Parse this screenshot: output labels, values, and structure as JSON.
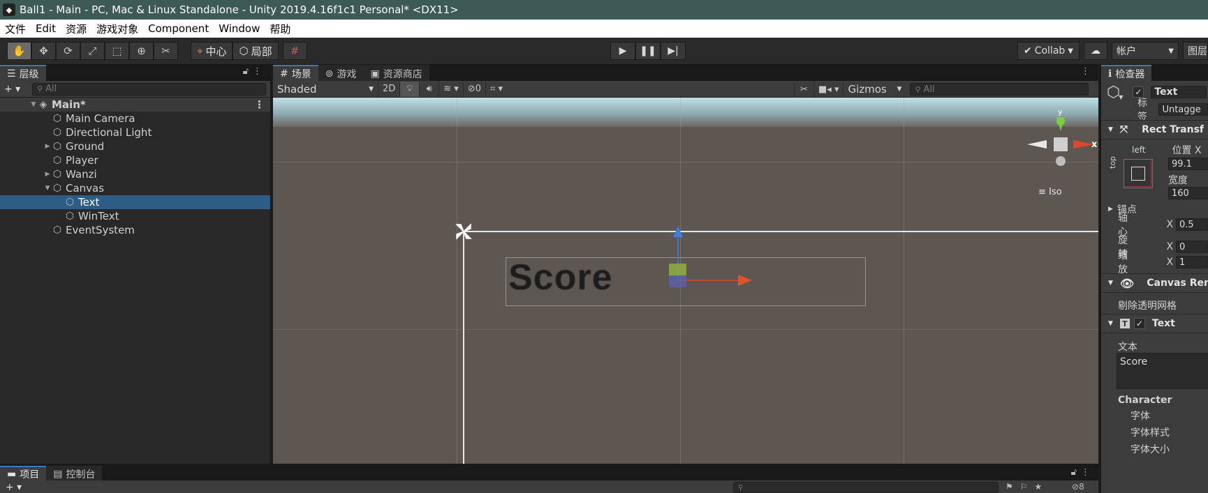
{
  "window": {
    "title": "Ball1 - Main - PC, Mac & Linux Standalone - Unity 2019.4.16f1c1 Personal* <DX11>"
  },
  "menu": [
    "文件",
    "Edit",
    "资源",
    "游戏对象",
    "Component",
    "Window",
    "帮助"
  ],
  "toolbar": {
    "pivot_center": "中心",
    "pivot_local": "局部",
    "collab": "Collab",
    "account": "帐户",
    "layout": "图层"
  },
  "hierarchy": {
    "tab": "层级",
    "search_placeholder": "All",
    "scene": "Main*",
    "items": [
      {
        "label": "Main Camera"
      },
      {
        "label": "Directional Light"
      },
      {
        "label": "Ground"
      },
      {
        "label": "Player"
      },
      {
        "label": "Wanzi"
      },
      {
        "label": "Canvas"
      },
      {
        "label": "Text"
      },
      {
        "label": "WinText"
      },
      {
        "label": "EventSystem"
      }
    ]
  },
  "scene_view": {
    "tabs": [
      "场景",
      "游戏",
      "资源商店"
    ],
    "shading": "Shaded",
    "mode_2d": "2D",
    "hidden_count": "0",
    "gizmos": "Gizmos",
    "search_placeholder": "All",
    "score_text": "Score",
    "axis_x": "x",
    "iso": "Iso"
  },
  "inspector": {
    "tab": "检查器",
    "object_name": "Text",
    "tag_label": "标签",
    "tag_value": "Untagge",
    "rect_transform": "Rect Transf",
    "anchor_h": "left",
    "anchor_v": "top",
    "pos_x_label": "位置 X",
    "pos_x": "99.1",
    "width_label": "宽度",
    "width": "160",
    "anchors": "锚点",
    "pivot_label": "轴心",
    "pivot_x": "0.5",
    "rotation_label": "旋转",
    "rotation_x": "0",
    "scale_label": "缩放",
    "scale_x": "1",
    "axis": "X",
    "canvas_renderer": "Canvas Ren",
    "cull_transparent": "剔除透明网格",
    "text_component": "Text",
    "text_label": "文本",
    "text_value": "Score",
    "character": "Character",
    "font": "字体",
    "font_style": "字体样式",
    "font_size": "字体大小"
  },
  "bottom": {
    "tabs": [
      "项目",
      "控制台"
    ],
    "hidden_count": "8"
  }
}
